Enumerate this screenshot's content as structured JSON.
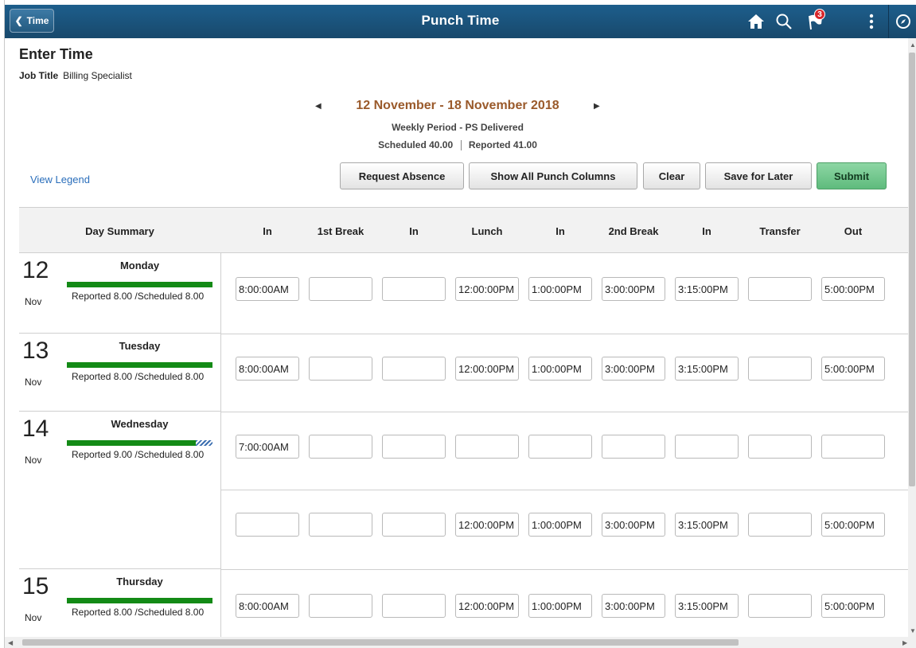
{
  "app": {
    "back_label": "Time",
    "title": "Punch Time",
    "notification_count": "3",
    "icons": [
      "back-chevron-icon",
      "home-icon",
      "search-icon",
      "flag-icon",
      "more-icon",
      "navbar-compass-icon"
    ]
  },
  "page": {
    "title": "Enter Time",
    "job_title_label": "Job Title",
    "job_title_value": "Billing Specialist"
  },
  "period": {
    "range": "12 November - 18 November 2018",
    "type": "Weekly Period - PS Delivered",
    "scheduled_label": "Scheduled",
    "scheduled_value": "40.00",
    "reported_label": "Reported",
    "reported_value": "41.00"
  },
  "actions": {
    "legend": "View Legend",
    "request_absence": "Request Absence",
    "show_all": "Show All Punch Columns",
    "clear": "Clear",
    "save_later": "Save for Later",
    "submit": "Submit"
  },
  "columns": [
    "Day Summary",
    "In",
    "1st Break",
    "In",
    "Lunch",
    "In",
    "2nd Break",
    "In",
    "Transfer",
    "Out"
  ],
  "days": [
    {
      "num": "12",
      "month": "Nov",
      "name": "Monday",
      "reported": "Reported 8.00 /Scheduled 8.00",
      "bar_fraction": 1.0
    },
    {
      "num": "13",
      "month": "Nov",
      "name": "Tuesday",
      "reported": "Reported 8.00 /Scheduled 8.00",
      "bar_fraction": 1.0
    },
    {
      "num": "14",
      "month": "Nov",
      "name": "Wednesday",
      "reported": "Reported 9.00 /Scheduled 8.00",
      "bar_fraction": 1.0
    },
    {
      "num": "15",
      "month": "Nov",
      "name": "Thursday",
      "reported": "Reported 8.00 /Scheduled 8.00",
      "bar_fraction": 1.0
    }
  ],
  "rows": [
    [
      "8:00:00AM",
      "",
      "",
      "12:00:00PM",
      "1:00:00PM",
      "3:00:00PM",
      "3:15:00PM",
      "",
      "5:00:00PM"
    ],
    [
      "8:00:00AM",
      "",
      "",
      "12:00:00PM",
      "1:00:00PM",
      "3:00:00PM",
      "3:15:00PM",
      "",
      "5:00:00PM"
    ],
    [
      "7:00:00AM",
      "",
      "",
      "",
      "",
      "",
      "",
      "",
      ""
    ],
    [
      "",
      "",
      "",
      "12:00:00PM",
      "1:00:00PM",
      "3:00:00PM",
      "3:15:00PM",
      "",
      "5:00:00PM"
    ],
    [
      "8:00:00AM",
      "",
      "",
      "12:00:00PM",
      "1:00:00PM",
      "3:00:00PM",
      "3:15:00PM",
      "",
      "5:00:00PM"
    ]
  ]
}
